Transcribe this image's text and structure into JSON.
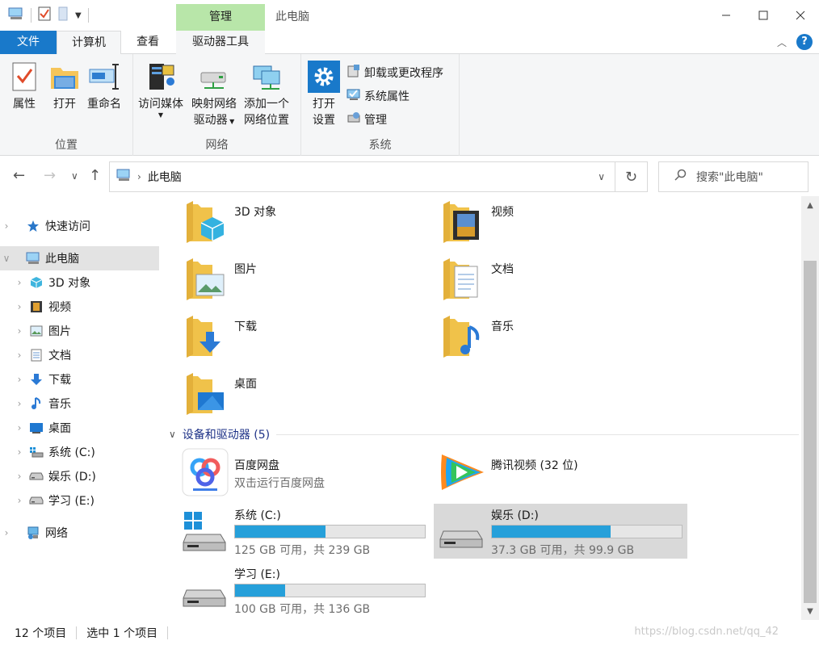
{
  "window": {
    "title": "此电脑",
    "context_tab_label": "管理"
  },
  "ribbon_tabs": {
    "file": "文件",
    "computer": "计算机",
    "view": "查看",
    "drive_tools": "驱动器工具"
  },
  "ribbon": {
    "location_group": "位置",
    "properties": "属性",
    "open": "打开",
    "rename": "重命名",
    "network_group": "网络",
    "access_media": "访问媒体",
    "map_drive_line1": "映射网络",
    "map_drive_line2": "驱动器",
    "add_location_line1": "添加一个",
    "add_location_line2": "网络位置",
    "system_group": "系统",
    "open_settings_line1": "打开",
    "open_settings_line2": "设置",
    "uninstall": "卸载或更改程序",
    "system_properties": "系统属性",
    "manage": "管理"
  },
  "address": {
    "path": "此电脑",
    "search_placeholder": "搜索\"此电脑\""
  },
  "nav": {
    "quick_access": "快速访问",
    "this_pc": "此电脑",
    "objects_3d": "3D 对象",
    "videos": "视频",
    "pictures": "图片",
    "documents": "文档",
    "downloads": "下载",
    "music": "音乐",
    "desktop": "桌面",
    "drive_c": "系统 (C:)",
    "drive_d": "娱乐 (D:)",
    "drive_e": "学习 (E:)",
    "network": "网络"
  },
  "folders": {
    "objects_3d": "3D 对象",
    "videos": "视频",
    "pictures": "图片",
    "documents": "文档",
    "downloads": "下载",
    "music": "音乐",
    "desktop": "桌面"
  },
  "devices_header": "设备和驱动器 (5)",
  "devices": {
    "baidu_name": "百度网盘",
    "baidu_sub": "双击运行百度网盘",
    "tencent_name": "腾讯视频 (32 位)",
    "drive_c": {
      "name": "系统 (C:)",
      "space": "125 GB 可用，共 239 GB",
      "used_fraction": 0.477
    },
    "drive_d": {
      "name": "娱乐 (D:)",
      "space": "37.3 GB 可用，共 99.9 GB",
      "used_fraction": 0.627
    },
    "drive_e": {
      "name": "学习 (E:)",
      "space": "100 GB 可用，共 136 GB",
      "used_fraction": 0.265
    }
  },
  "status": {
    "items": "12 个项目",
    "selected": "选中 1 个项目"
  },
  "watermark": "https://blog.csdn.net/qq_42",
  "colors": {
    "accent": "#1979ca",
    "drive_bar": "#26a0da",
    "context_tab": "#b8e6a9",
    "group_header": "#1e3287"
  }
}
